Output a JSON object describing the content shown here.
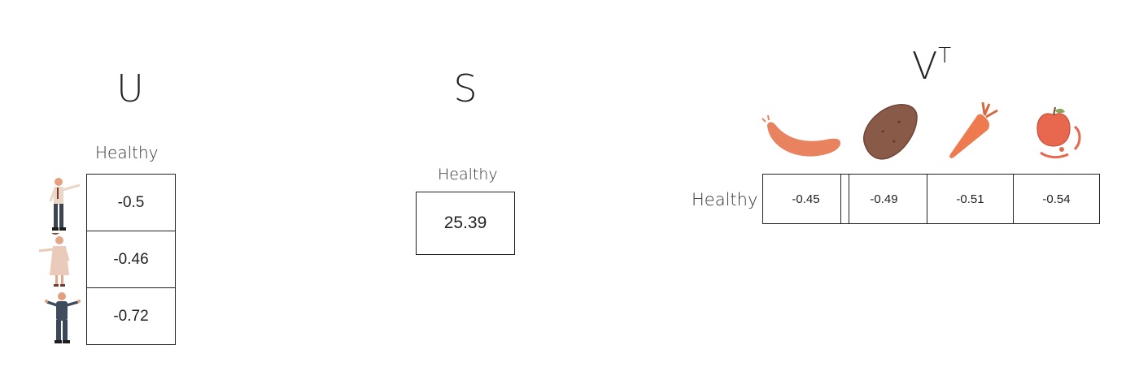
{
  "u": {
    "title": "U",
    "column_label": "Healthy",
    "values": [
      "-0.5",
      "-0.46",
      "-0.72"
    ],
    "people_icons": [
      "man-pointing-icon",
      "woman-pointing-icon",
      "man-shrugging-icon"
    ]
  },
  "s": {
    "title": "S",
    "column_label": "Healthy",
    "value": "25.39"
  },
  "vt": {
    "title": "V",
    "superscript": "T",
    "row_label": "Healthy",
    "values": [
      "-0.45",
      "-0.49",
      "-0.51",
      "-0.54"
    ],
    "food_icons": [
      "sausage-icon",
      "potato-icon",
      "carrot-icon",
      "apple-icon"
    ]
  },
  "colors": {
    "sausage": "#e9825f",
    "potato": "#8a5a49",
    "carrot": "#ee7a4f",
    "apple": "#e8684f"
  }
}
